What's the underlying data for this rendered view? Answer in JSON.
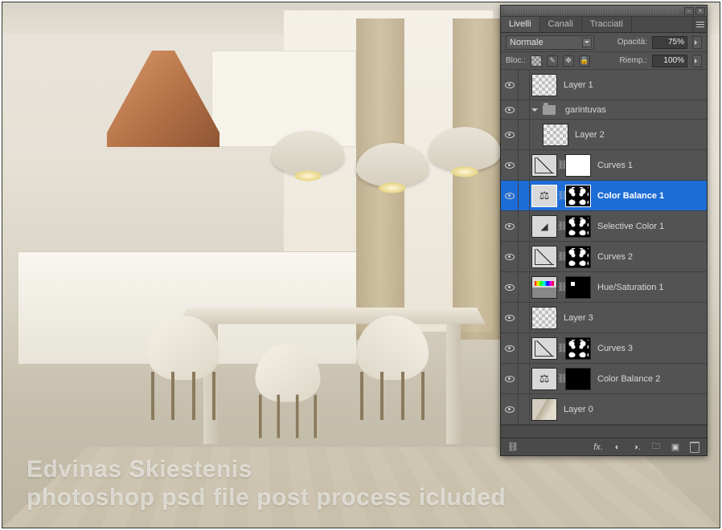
{
  "credit": {
    "line1": "Edvinas Skiestenis",
    "line2": "photoshop psd file post process icluded"
  },
  "panel": {
    "tabs": [
      "Livelli",
      "Canali",
      "Tracciati"
    ],
    "active_tab": 0,
    "blend_mode": "Normale",
    "opacity_label": "Opacità:",
    "opacity_value": "75%",
    "lock_label": "Bloc.:",
    "fill_label": "Riemp.:",
    "fill_value": "100%",
    "lock_icons": [
      "transparent-lock",
      "brush-lock",
      "move-lock",
      "full-lock"
    ]
  },
  "layers": [
    {
      "name": "Layer 1",
      "type": "raster",
      "thumb": "transparent",
      "depth": 0,
      "visible": true
    },
    {
      "name": "garintuvas",
      "type": "group",
      "depth": 0,
      "visible": true,
      "expanded": true
    },
    {
      "name": "Layer 2",
      "type": "raster",
      "thumb": "transparent",
      "depth": 1,
      "visible": true
    },
    {
      "name": "Curves 1",
      "type": "adjustment",
      "adj": "curves",
      "mask": "white",
      "depth": 0,
      "visible": true
    },
    {
      "name": "Color Balance 1",
      "type": "adjustment",
      "adj": "balance",
      "mask": "mask-spots",
      "depth": 0,
      "visible": true,
      "selected": true
    },
    {
      "name": "Selective Color 1",
      "type": "adjustment",
      "adj": "selcolor",
      "mask": "mask-spots",
      "depth": 0,
      "visible": true
    },
    {
      "name": "Curves 2",
      "type": "adjustment",
      "adj": "curves",
      "mask": "mask-spots",
      "depth": 0,
      "visible": true
    },
    {
      "name": "Hue/Saturation 1",
      "type": "adjustment",
      "adj": "huesat",
      "mask": "mask-dot",
      "depth": 0,
      "visible": true
    },
    {
      "name": "Layer 3",
      "type": "raster",
      "thumb": "transparent",
      "depth": 0,
      "visible": true
    },
    {
      "name": "Curves 3",
      "type": "adjustment",
      "adj": "curves",
      "mask": "mask-spots",
      "depth": 0,
      "visible": true
    },
    {
      "name": "Color Balance 2",
      "type": "adjustment",
      "adj": "balance",
      "mask": "black",
      "depth": 0,
      "visible": true
    },
    {
      "name": "Layer 0",
      "type": "raster",
      "thumb": "photo",
      "depth": 0,
      "visible": true
    }
  ],
  "footer_icons": [
    "link",
    "fx",
    "mask",
    "adjustment",
    "group",
    "new-layer",
    "trash"
  ]
}
